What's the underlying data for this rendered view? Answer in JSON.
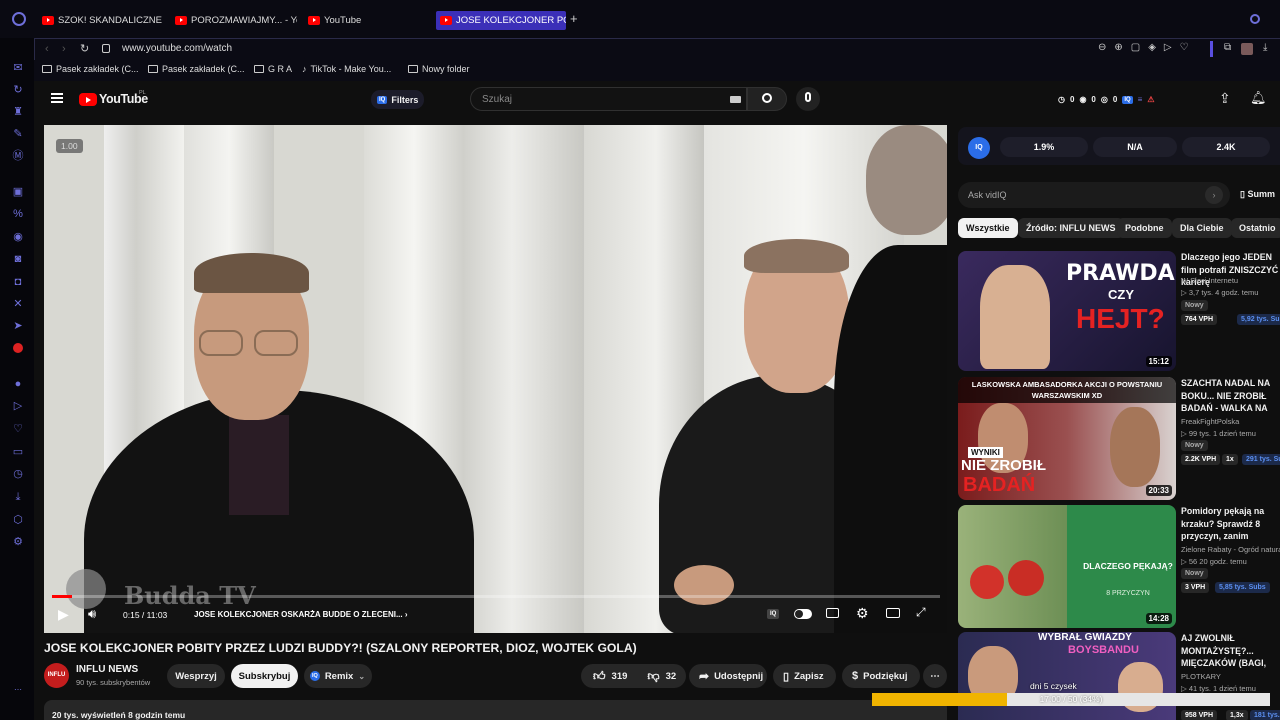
{
  "tabs": [
    {
      "label": "SZOK! SKANDALICZNE ZA"
    },
    {
      "label": "POROZMAWIAJMY... - You"
    },
    {
      "label": "YouTube"
    },
    {
      "label": "JOSE KOLEKCJONER POBI"
    }
  ],
  "address": {
    "url": "www.youtube.com/watch"
  },
  "bookmarks": [
    {
      "label": "Pasek zakładek (C..."
    },
    {
      "label": "Pasek zakładek (C..."
    },
    {
      "label": "G R A"
    },
    {
      "label": "TikTok - Make You..."
    },
    {
      "label": "Nowy folder"
    }
  ],
  "youtube": {
    "logo": "YouTube",
    "region": "PL",
    "filters": "Filters",
    "search_placeholder": "Szukaj",
    "counters": [
      "0",
      "0",
      "0"
    ]
  },
  "player": {
    "speed": "1.00",
    "time": "0:15 / 11:03",
    "chapter": "JOSE KOLEKCJONER OSKARŻA BUDDE O ZLECENI...",
    "watermark": "Budda TV",
    "progress": 0.023
  },
  "video": {
    "title": "JOSE KOLEKCJONER POBITY PRZEZ LUDZI BUDDY?! (SZALONY REPORTER, DIOZ, WOJTEK GOLA)",
    "channel": "INFLU NEWS",
    "subscribers": "90 tys. subskrybentów",
    "views_line": "20 tys. wyświetleń  8 godzin temu",
    "buttons": {
      "support": "Wesprzyj",
      "subscribe": "Subskrybuj",
      "remix": "Remix",
      "likes": "319",
      "dislikes": "32",
      "share": "Udostępnij",
      "save": "Zapisz",
      "thanks": "Podziękuj"
    }
  },
  "vidiq": {
    "badge": "IQ",
    "stats": [
      "1.9%",
      "N/A",
      "2.4K"
    ],
    "ask_placeholder": "Ask vidIQ",
    "summary": "Summ"
  },
  "chips": [
    "Wszystkie",
    "Źródło: INFLU NEWS",
    "Podobne",
    "Dla Ciebie",
    "Ostatnio"
  ],
  "recommendations": [
    {
      "title": "Dlaczego jego JEDEN film potrafi ZNISZCZYĆ karierę",
      "channel": "W Sieci Internetu",
      "meta": "▷ 3,7 tys.   4 godz. temu",
      "new": "Nowy",
      "vph": "764 VPH",
      "subs": "5,92 tys. Subs",
      "duration": "15:12",
      "thumb_top": "PRAWDA",
      "thumb_mid": "CZY",
      "thumb_bot": "HEJT?"
    },
    {
      "title": "SZACHTA NADAL NA BOKU... NIE ZROBIŁ BADAŃ - WALKA NA BALONACH (FAME, KASJ...",
      "channel": "FreakFightPolska",
      "meta": "▷ 99 tys.   1 dzień temu",
      "new": "Nowy",
      "vph": "2.2K VPH",
      "ratio": "1x",
      "subs": "291 tys. Subs",
      "duration": "20:33",
      "thumb_top": "LASKOWSKA AMBASADORKA AKCJI O POWSTANIU WARSZAWSKIM XD",
      "thumb_mid": "NIE ZROBIŁ",
      "thumb_bot": "BADAŃ",
      "thumb_tag": "WYNIKI"
    },
    {
      "title": "Pomidory pękają na krzaku? Sprawdź 8 przyczyn, zanim stracisz plony",
      "channel": "Zielone Rabaty - Ogród naturalny",
      "meta": "▷ 56   20 godz. temu",
      "new": "Nowy",
      "vph": "3 VPH",
      "subs": "5,85 tys. Subs",
      "duration": "14:28",
      "thumb_top": "DLACZEGO PĘKAJĄ?",
      "thumb_bot": "8 PRZYCZYN"
    },
    {
      "title": "AJ ZWOLNIŁ MONTAŻYSTĘ?... MIĘCZAKÓW (BAGI, SUZ... MORTALCIO, MARTYNIUK",
      "channel": "PLOTKARY",
      "meta": "▷ 41 tys.   1 dzień temu",
      "vph": "958 VPH",
      "ratio": "1,3x",
      "subs": "181 tys.",
      "thumb_top": "WYBRAŁ GWIAZDY",
      "thumb_bot": "BOYSBANDU"
    }
  ],
  "overlay": {
    "line1": "dni 5 czysek",
    "line2": "17:00 / 50 (34%)",
    "fraction": 0.34
  },
  "colors": {
    "accent": "#3b2fb8",
    "brand": "#ff0000",
    "vidiq": "#2b6de8"
  }
}
